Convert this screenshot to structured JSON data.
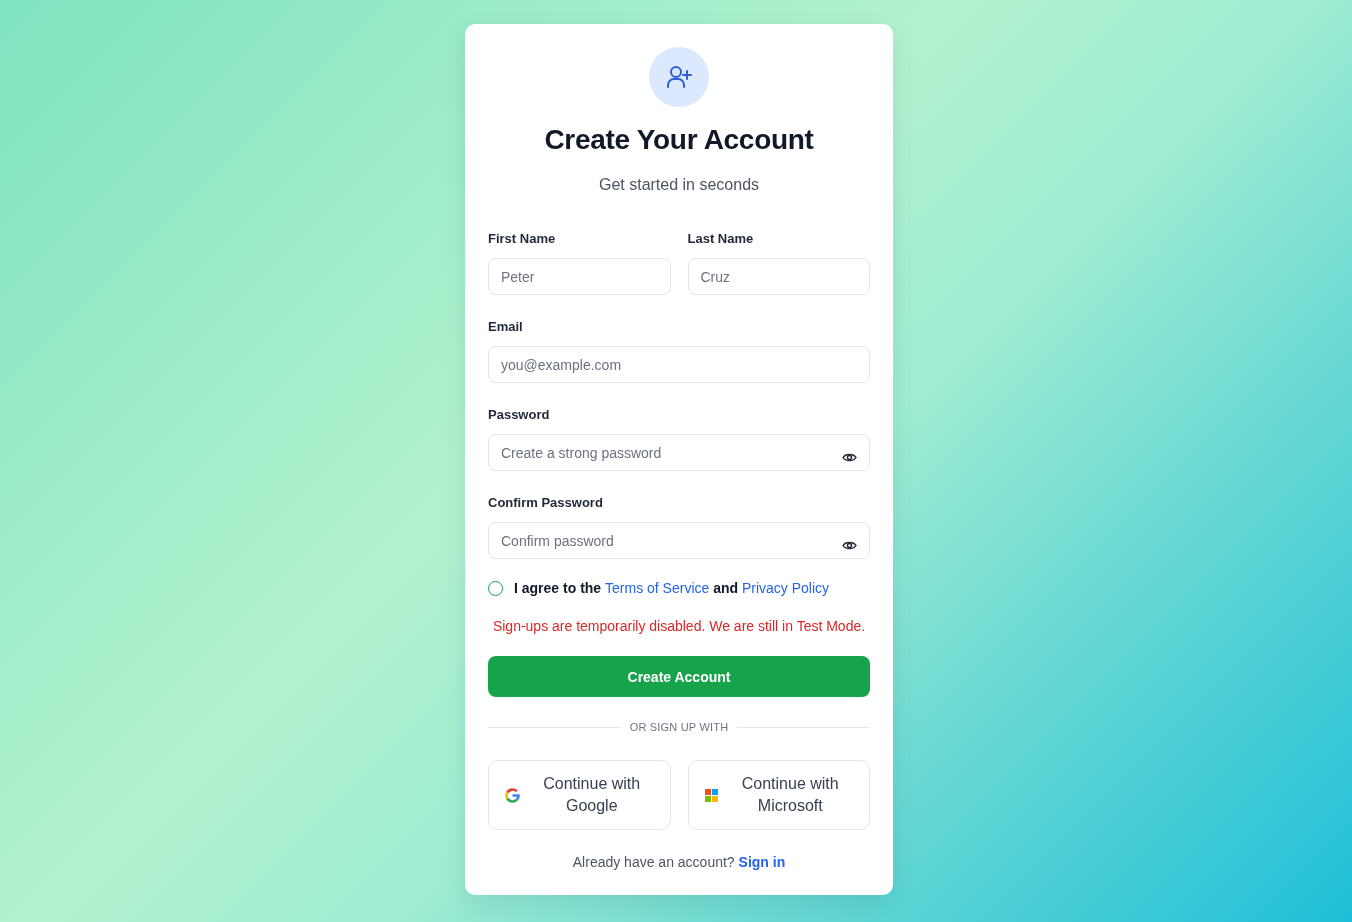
{
  "header": {
    "title": "Create Your Account",
    "subtitle": "Get started in seconds"
  },
  "name_row": [
    {
      "label": "First Name",
      "placeholder": "Peter"
    },
    {
      "label": "Last Name",
      "placeholder": "Cruz"
    }
  ],
  "fields": [
    {
      "label": "Email",
      "placeholder": "you@example.com",
      "kind": "email"
    },
    {
      "label": "Password",
      "placeholder": "Create a strong password",
      "kind": "password"
    },
    {
      "label": "Confirm Password",
      "placeholder": "Confirm password",
      "kind": "password"
    }
  ],
  "agreement": {
    "checked": false,
    "parts": [
      {
        "text": "I agree to the",
        "kind": "text"
      },
      {
        "text": "Terms of Service",
        "kind": "link"
      },
      {
        "text": "and",
        "kind": "text"
      },
      {
        "text": "Privacy Policy",
        "kind": "link"
      }
    ]
  },
  "error": "Sign-ups are temporarily disabled. We are still in Test Mode.",
  "submit": {
    "label": "Create Account"
  },
  "divider": "OR SIGN UP WITH",
  "social": [
    {
      "label": "Continue with Google",
      "kind": "google"
    },
    {
      "label": "Continue with Microsoft",
      "kind": "microsoft"
    }
  ],
  "footer": {
    "text": "Already have an account?",
    "link": "Sign in"
  }
}
